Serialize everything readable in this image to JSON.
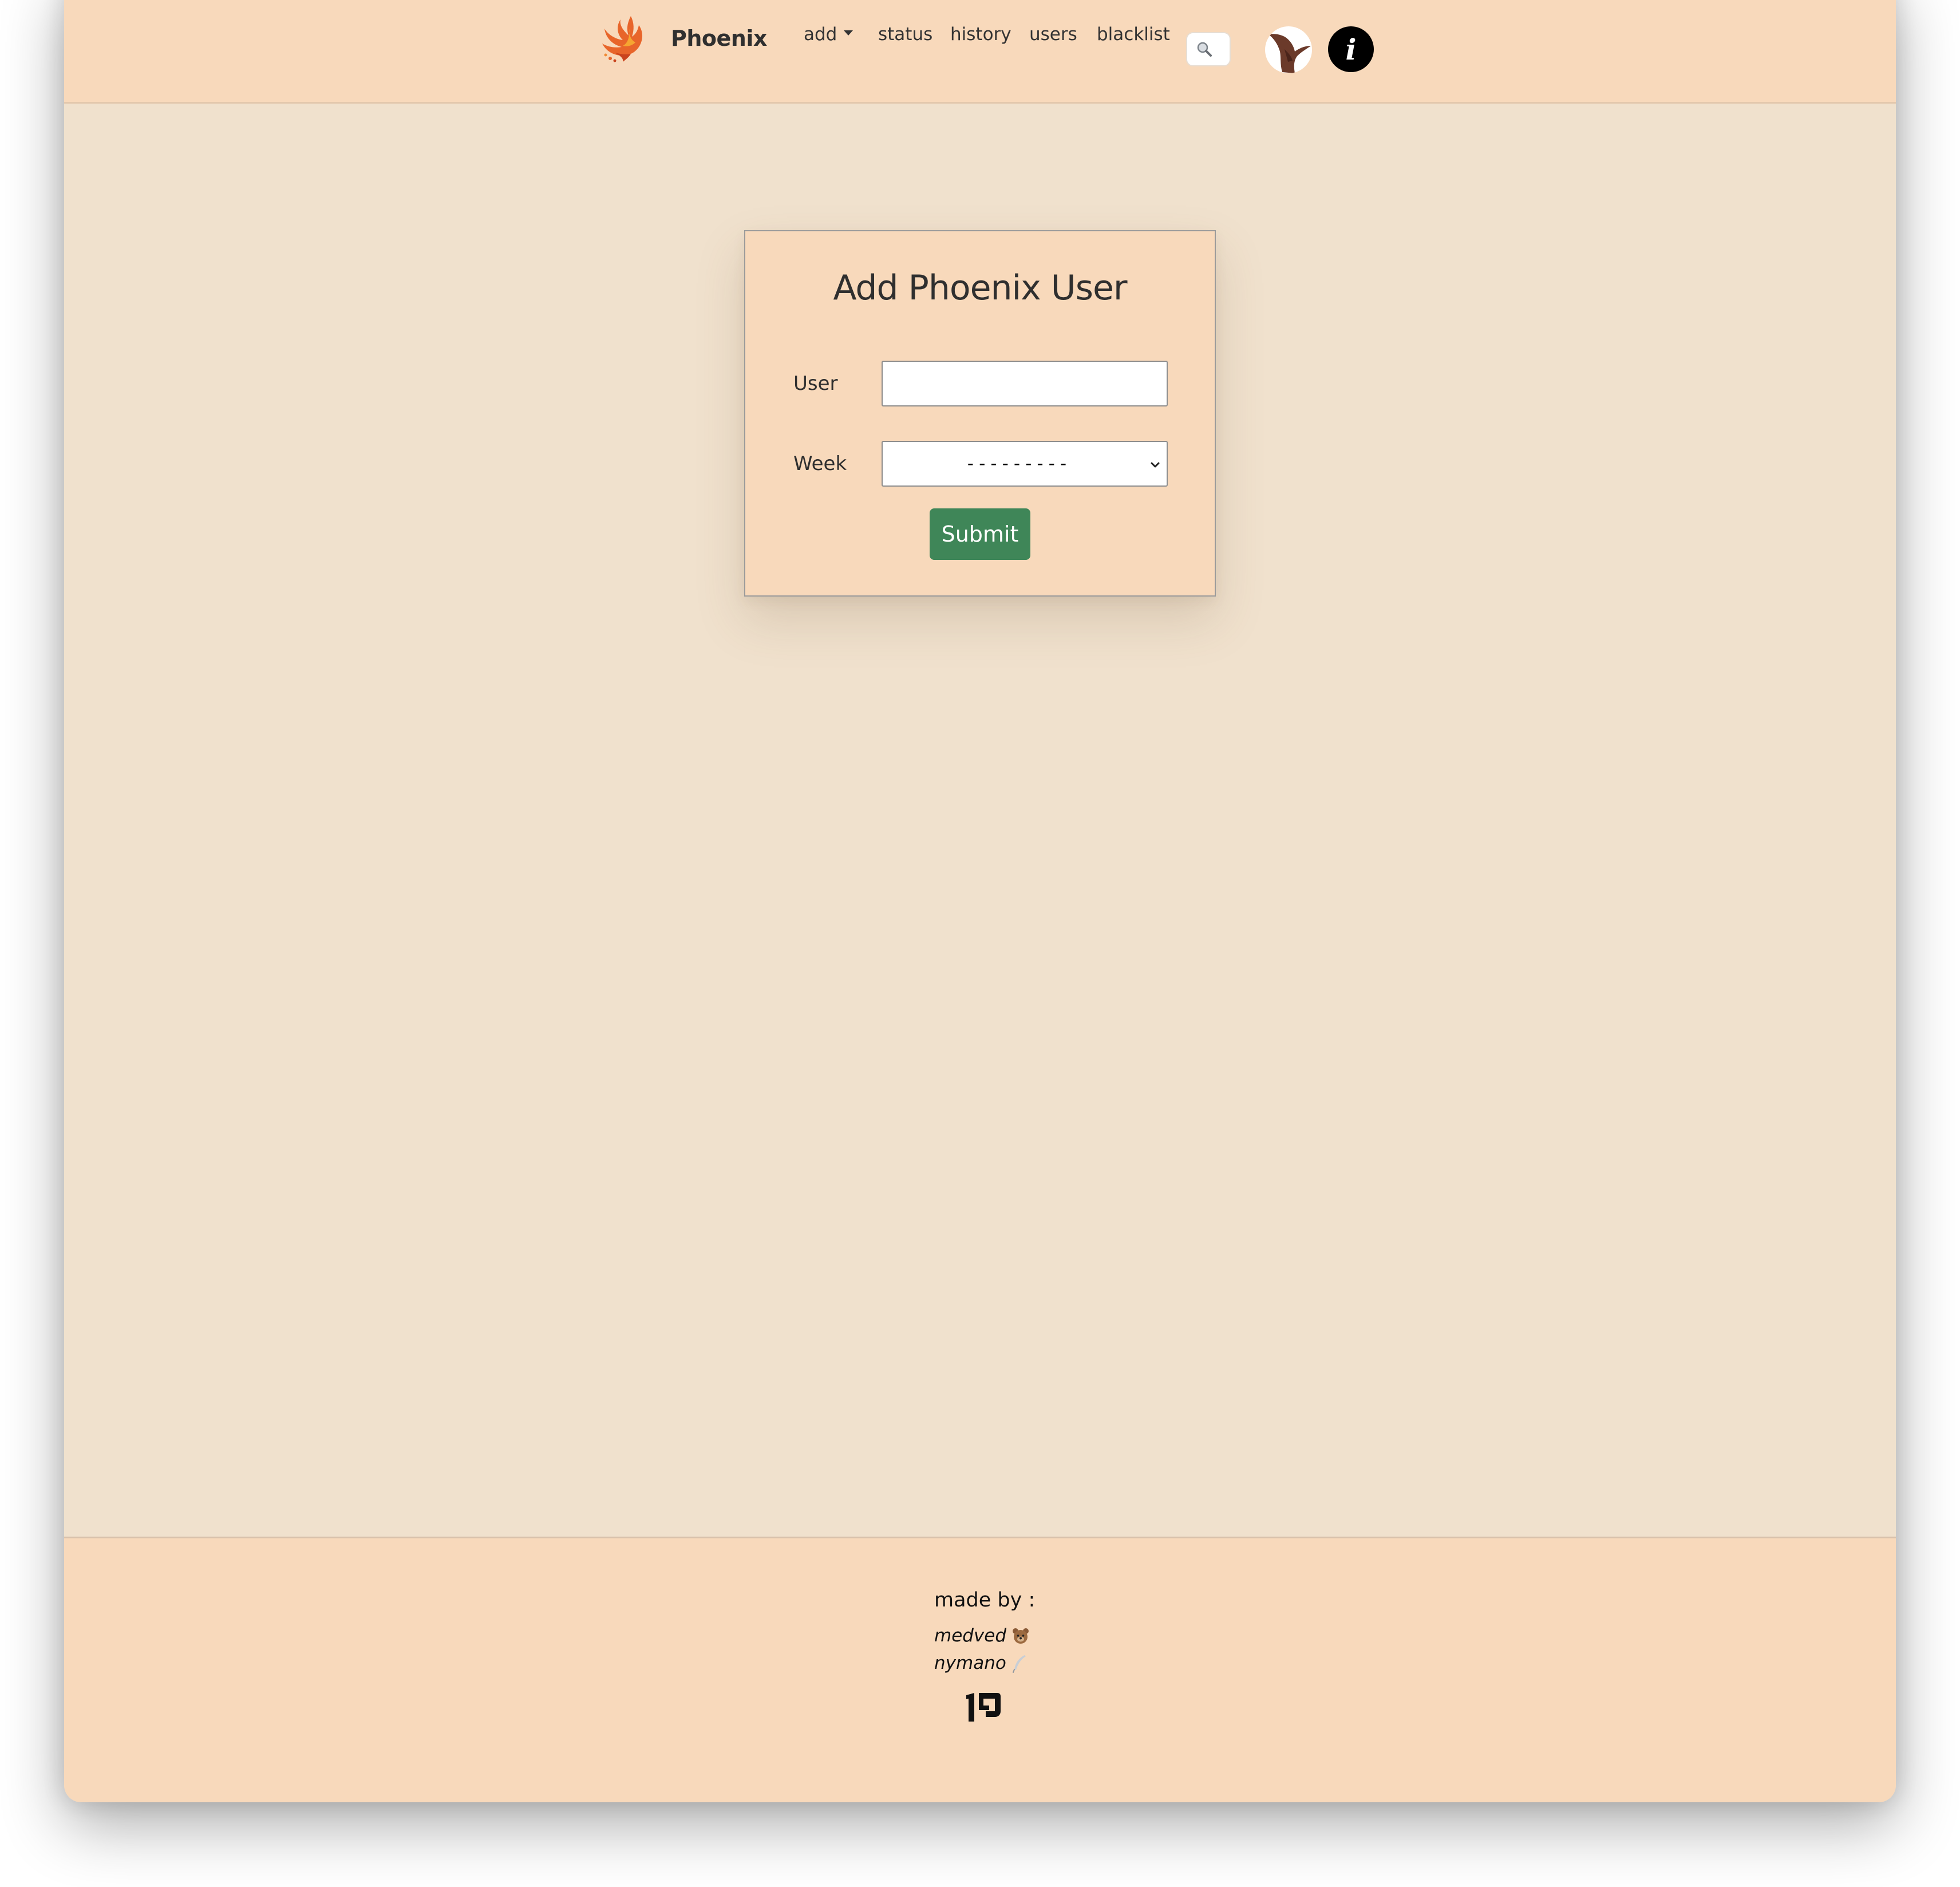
{
  "navbar": {
    "brand_name": "Phoenix",
    "menu": {
      "add": "add",
      "status": "status",
      "history": "history",
      "users": "users",
      "blacklist": "blacklist"
    },
    "info_glyph": "i",
    "icons": {
      "logo": "phoenix-bird-icon",
      "dropdown": "caret-down-icon",
      "search": "magnifier-icon",
      "avatar": "bird-avatar-icon",
      "info": "info-icon"
    }
  },
  "form": {
    "title": "Add Phoenix User",
    "user_label": "User",
    "user_value": "",
    "week_label": "Week",
    "week_selected": "---------",
    "submit_label": "Submit"
  },
  "footer": {
    "heading": "made by :",
    "authors": [
      {
        "name": "medved",
        "emoji_icon": "bear-face-icon"
      },
      {
        "name": "nymano",
        "emoji_icon": "feather-quill-icon"
      }
    ],
    "logo_icon": "hebrew-letter-logo-icon"
  },
  "colors": {
    "page_background": "#f0e1cd",
    "bar_background": "#f8d9bb",
    "submit_button": "#3f8658",
    "text": "#2f2f2f"
  }
}
